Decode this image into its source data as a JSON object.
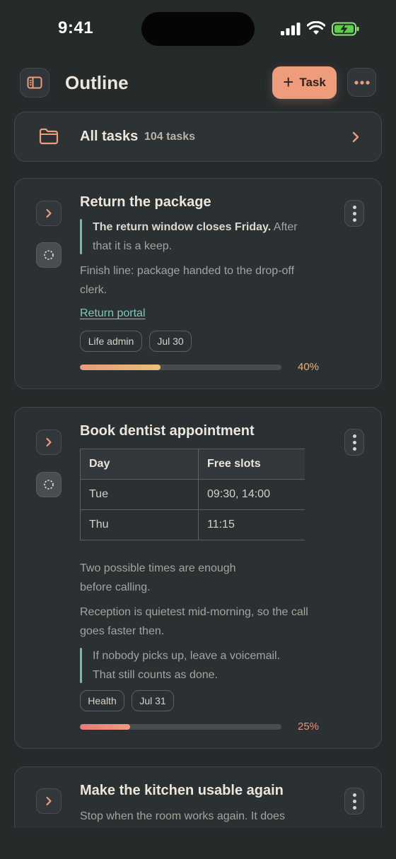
{
  "status_bar": {
    "time": "9:41"
  },
  "header": {
    "title": "Outline",
    "add_task_label": "Task"
  },
  "all_tasks": {
    "label": "All tasks",
    "count": "104 tasks"
  },
  "colors": {
    "accent": "#ee9c7b",
    "quote_bar": "#6cbcb3",
    "link": "#7fc7bd"
  },
  "cards": [
    {
      "title": "Return the package",
      "quote_bold": "The return window closes Friday.",
      "quote_rest": " After that it is a keep.",
      "note": "Finish line: package handed to the drop-off clerk.",
      "link": "Return portal",
      "tags": [
        "Life admin",
        "Jul 30"
      ],
      "progress": 0.4,
      "progress_label": "40%"
    },
    {
      "title": "Book dentist appointment",
      "table": {
        "headers": [
          "Day",
          "Free slots"
        ],
        "rows": [
          [
            "Tue",
            "09:30, 14:00"
          ],
          [
            "Thu",
            "11:15"
          ]
        ]
      },
      "paragraph1": "Two possible times are enough before calling.",
      "paragraph2": "Reception is quietest mid-morning, so the call goes faster then.",
      "quote": "If nobody picks up, leave a voicemail. That still counts as done.",
      "tags": [
        "Health",
        "Jul 31"
      ],
      "progress": 0.25,
      "progress_label": "25%"
    },
    {
      "title": "Make the kitchen usable again",
      "note": "Stop when the room works again. It does"
    }
  ]
}
